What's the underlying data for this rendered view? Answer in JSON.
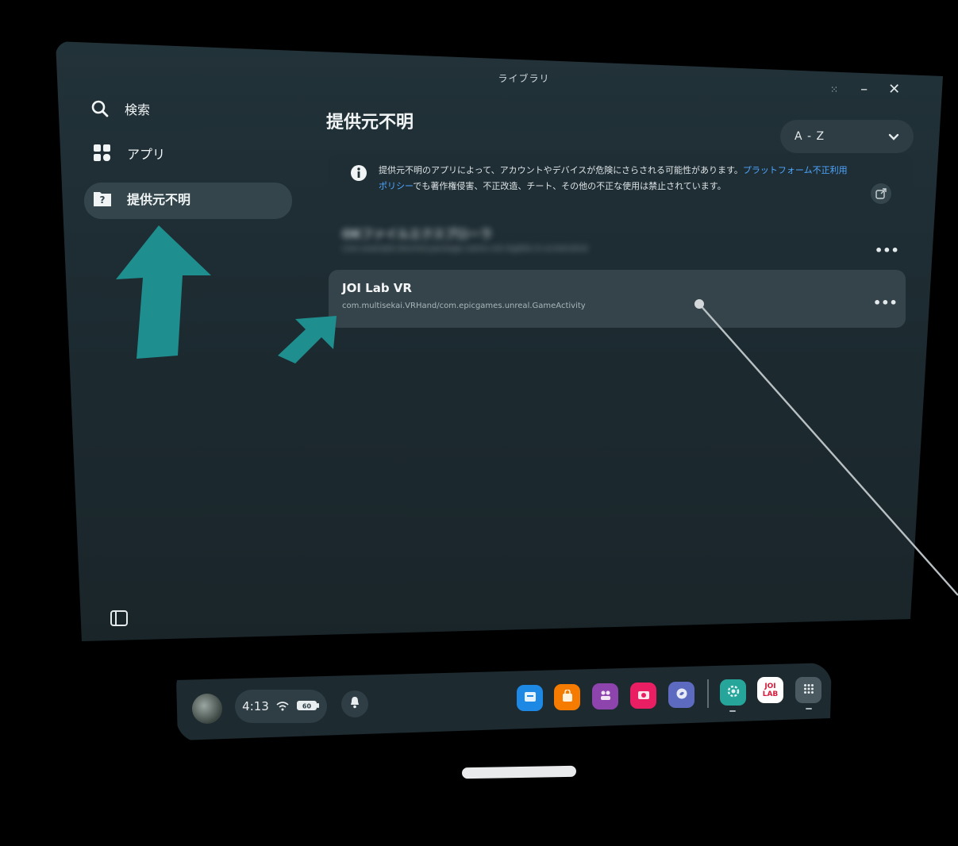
{
  "window": {
    "title": "ライブラリ"
  },
  "sidebar": {
    "items": [
      {
        "label": "検索",
        "icon": "search-icon"
      },
      {
        "label": "アプリ",
        "icon": "apps-grid-icon"
      },
      {
        "label": "提供元不明",
        "icon": "unknown-source-folder-icon",
        "active": true
      }
    ]
  },
  "main": {
    "section_title": "提供元不明",
    "sort": {
      "selected": "A - Z"
    },
    "notice": {
      "text_before": "提供元不明のアプリによって、アカウントやデバイスが危険にさらされる可能性があります。",
      "link_text": "プラットフォーム不正利用ポリシー",
      "text_after": "でも著作権侵害、不正改造、チート、その他の不正な使用は禁止されています。"
    },
    "apps": [
      {
        "name": "OKファイルエクスプローラ",
        "package": "com.example.blurred.package.name.not.legible.in.screenshot",
        "blurred": true
      },
      {
        "name": "JOI Lab VR",
        "package": "com.multisekai.VRHand/com.epicgames.unreal.GameActivity",
        "blurred": false
      }
    ],
    "more_label": "•••"
  },
  "taskbar": {
    "time": "4:13",
    "battery_label": "60",
    "dock_apps": [
      {
        "name": "store",
        "color": "#1e88e5"
      },
      {
        "name": "shop",
        "color": "#f57c00"
      },
      {
        "name": "people",
        "color": "#8e44ad"
      },
      {
        "name": "camera",
        "color": "#e91e63"
      },
      {
        "name": "browser",
        "color": "#5c6bc0"
      },
      {
        "name": "settings",
        "color": "#26a69a"
      },
      {
        "name": "joi-lab",
        "label": "JOI LAB",
        "color": "#ffffff"
      },
      {
        "name": "all-apps",
        "color": "#4b5a60"
      }
    ]
  },
  "colors": {
    "accent": "#1e8c8c",
    "link": "#4ea6ff",
    "window_bg": "#1e2c32"
  }
}
